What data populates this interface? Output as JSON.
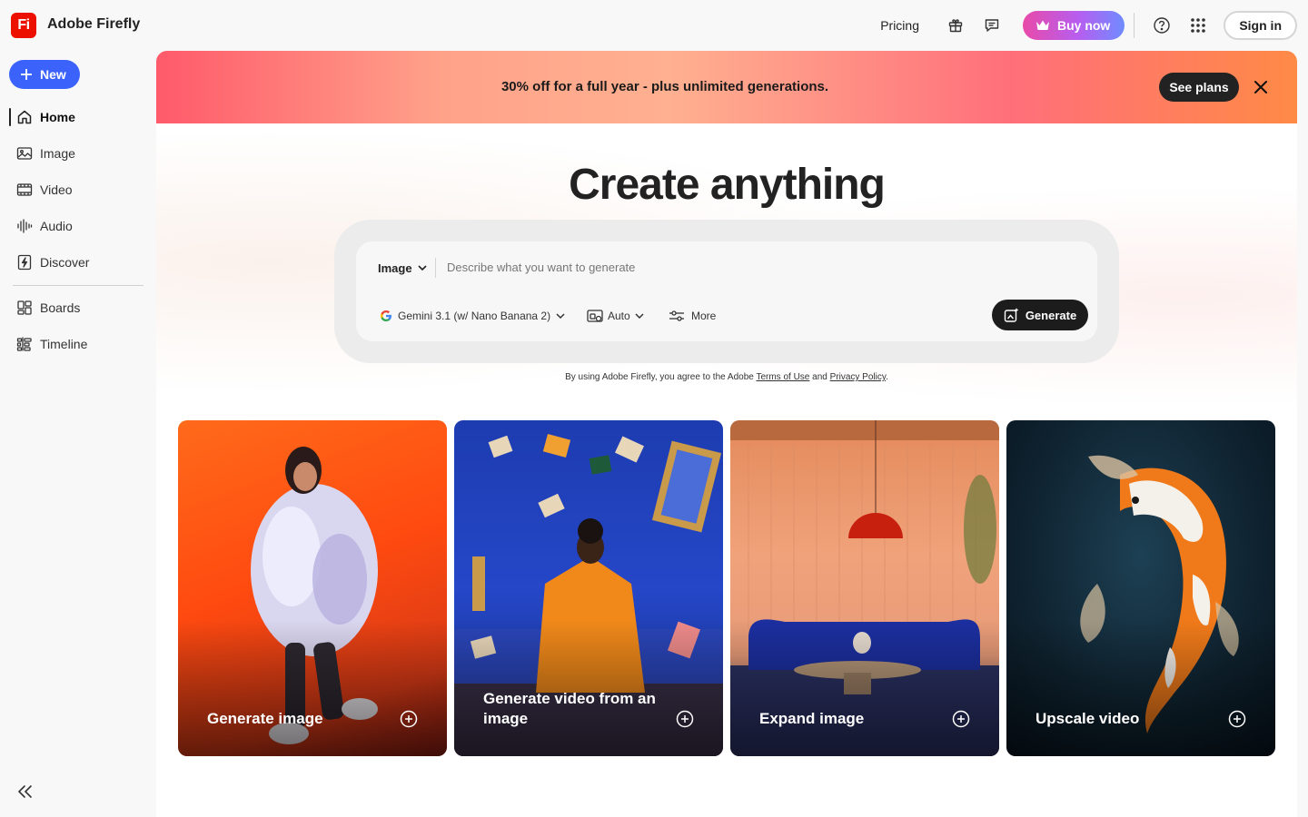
{
  "app": {
    "logo_text": "Fi",
    "title": "Adobe Firefly"
  },
  "topbar": {
    "pricing": "Pricing",
    "buy_now": "Buy now",
    "sign_in": "Sign in",
    "icons": [
      "gift-icon",
      "chat-icon",
      "help-icon",
      "apps-grid-icon"
    ]
  },
  "sidebar": {
    "new_label": "New",
    "items": [
      {
        "label": "Home",
        "icon": "home-icon",
        "active": true
      },
      {
        "label": "Image",
        "icon": "image-icon"
      },
      {
        "label": "Video",
        "icon": "video-icon"
      },
      {
        "label": "Audio",
        "icon": "audio-icon"
      },
      {
        "label": "Discover",
        "icon": "discover-icon"
      },
      {
        "label": "Boards",
        "icon": "boards-icon"
      },
      {
        "label": "Timeline",
        "icon": "timeline-icon"
      }
    ]
  },
  "banner": {
    "text": "30% off for a full year - plus unlimited generations.",
    "cta": "See plans"
  },
  "hero": {
    "title": "Create anything",
    "type_label": "Image",
    "placeholder": "Describe what you want to generate",
    "model": "Gemini 3.1 (w/ Nano Banana 2)",
    "aspect": "Auto",
    "more": "More",
    "generate": "Generate"
  },
  "legal": {
    "prefix": "By using Adobe Firefly, you agree to the Adobe",
    "terms": "Terms of Use",
    "and": "and",
    "privacy": "Privacy Policy",
    "suffix": "."
  },
  "cards": [
    {
      "label": "Generate image"
    },
    {
      "label": "Generate video from an image"
    },
    {
      "label": "Expand image"
    },
    {
      "label": "Upscale video"
    }
  ],
  "colors": {
    "brand_red": "#eb1000",
    "accent_blue": "#3b63fb",
    "dark": "#1c1c1c"
  }
}
